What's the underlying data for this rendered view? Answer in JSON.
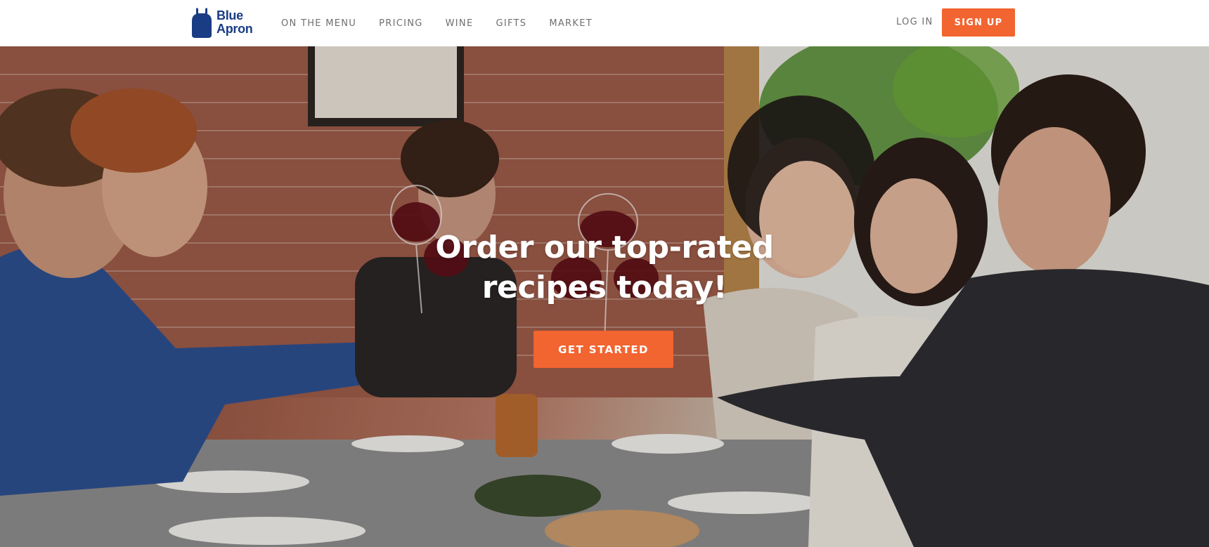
{
  "header": {
    "logo": {
      "line1": "Blue",
      "line2": "Apron",
      "icon": "apron-logo-icon",
      "color": "#1a3c84"
    },
    "nav": [
      {
        "label": "ON THE MENU"
      },
      {
        "label": "PRICING"
      },
      {
        "label": "WINE"
      },
      {
        "label": "GIFTS"
      },
      {
        "label": "MARKET"
      }
    ],
    "login_label": "LOG IN",
    "signup_label": "SIGN UP"
  },
  "hero": {
    "title_line1": "Order our top-rated",
    "title_line2": "recipes today!",
    "cta_label": "GET STARTED",
    "background_image": "friends-toasting-wine-at-dinner-table-photo"
  },
  "colors": {
    "accent": "#f26430",
    "brand": "#1a3c84",
    "nav_text": "#6f6f6f"
  }
}
